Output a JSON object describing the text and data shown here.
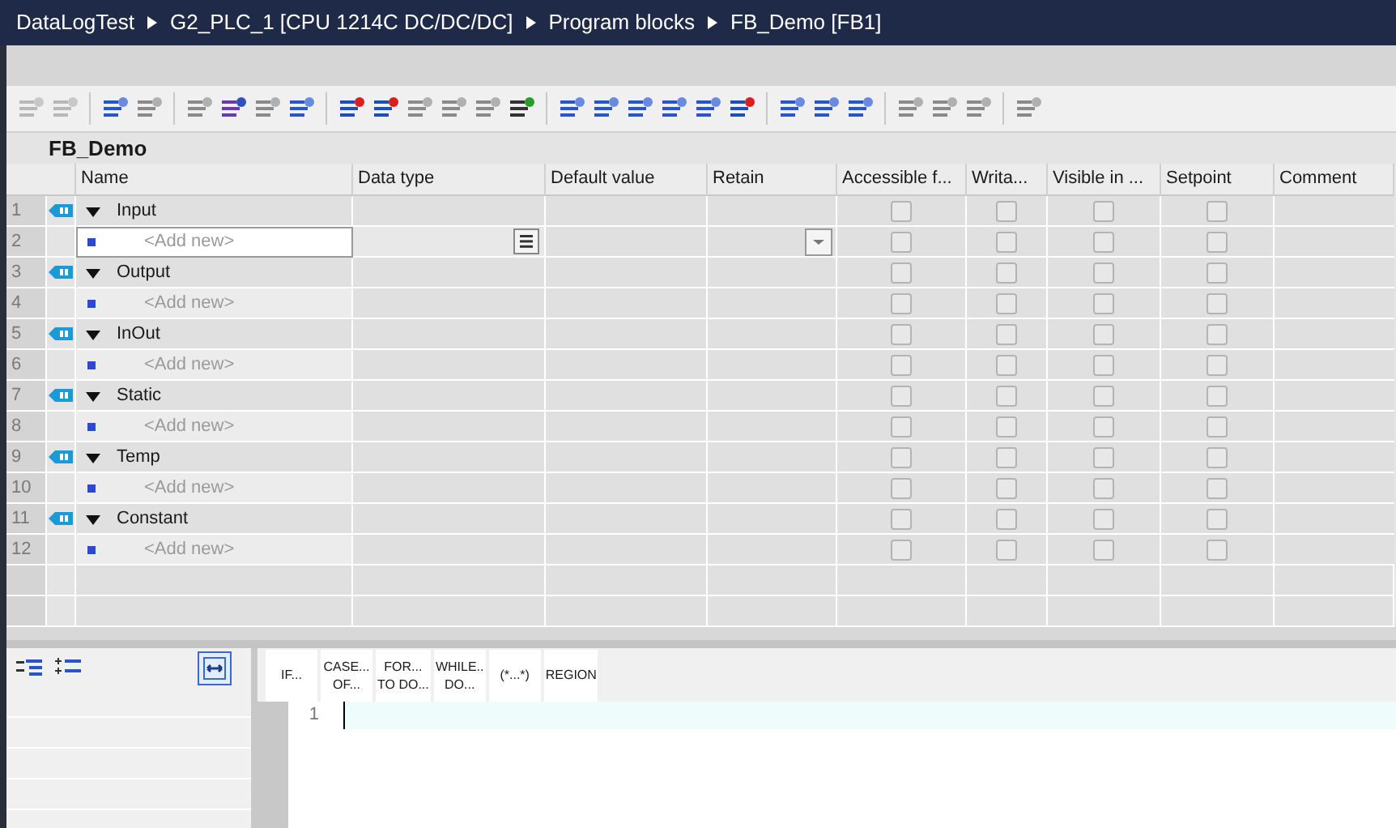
{
  "breadcrumb": [
    "DataLogTest",
    "G2_PLC_1 [CPU 1214C DC/DC/DC]",
    "Program blocks",
    "FB_Demo [FB1]"
  ],
  "block_title": "FB_Demo",
  "columns": [
    "Name",
    "Data type",
    "Default value",
    "Retain",
    "Accessible f...",
    "Writa...",
    "Visible in ...",
    "Setpoint",
    "Comment"
  ],
  "rows": [
    {
      "number": "1",
      "kind": "section",
      "name": "Input",
      "selected": false,
      "flags": [
        false,
        false,
        false,
        false
      ]
    },
    {
      "number": "2",
      "kind": "add",
      "name": "<Add new>",
      "selected": true,
      "flags": [
        false,
        false,
        false,
        false
      ]
    },
    {
      "number": "3",
      "kind": "section",
      "name": "Output",
      "selected": false,
      "flags": [
        false,
        false,
        false,
        false
      ]
    },
    {
      "number": "4",
      "kind": "add",
      "name": "<Add new>",
      "selected": false,
      "flags": [
        false,
        false,
        false,
        false
      ]
    },
    {
      "number": "5",
      "kind": "section",
      "name": "InOut",
      "selected": false,
      "flags": [
        false,
        false,
        false,
        false
      ]
    },
    {
      "number": "6",
      "kind": "add",
      "name": "<Add new>",
      "selected": false,
      "flags": [
        false,
        false,
        false,
        false
      ]
    },
    {
      "number": "7",
      "kind": "section",
      "name": "Static",
      "selected": false,
      "flags": [
        false,
        false,
        false,
        false
      ]
    },
    {
      "number": "8",
      "kind": "add",
      "name": "<Add new>",
      "selected": false,
      "flags": [
        false,
        false,
        false,
        false
      ]
    },
    {
      "number": "9",
      "kind": "section",
      "name": "Temp",
      "selected": false,
      "flags": [
        false,
        false,
        false,
        false
      ]
    },
    {
      "number": "10",
      "kind": "add",
      "name": "<Add new>",
      "selected": false,
      "flags": [
        false,
        false,
        false,
        false
      ]
    },
    {
      "number": "11",
      "kind": "section",
      "name": "Constant",
      "selected": false,
      "flags": [
        false,
        false,
        false,
        false
      ]
    },
    {
      "number": "12",
      "kind": "add",
      "name": "<Add new>",
      "selected": false,
      "flags": [
        false,
        false,
        false,
        false
      ]
    }
  ],
  "snippets": [
    "IF...",
    "CASE...\nOF...",
    "FOR...\nTO DO...",
    "WHILE..\nDO...",
    "(*...*)",
    "REGION"
  ],
  "editor": {
    "line_numbers": [
      "1"
    ]
  }
}
